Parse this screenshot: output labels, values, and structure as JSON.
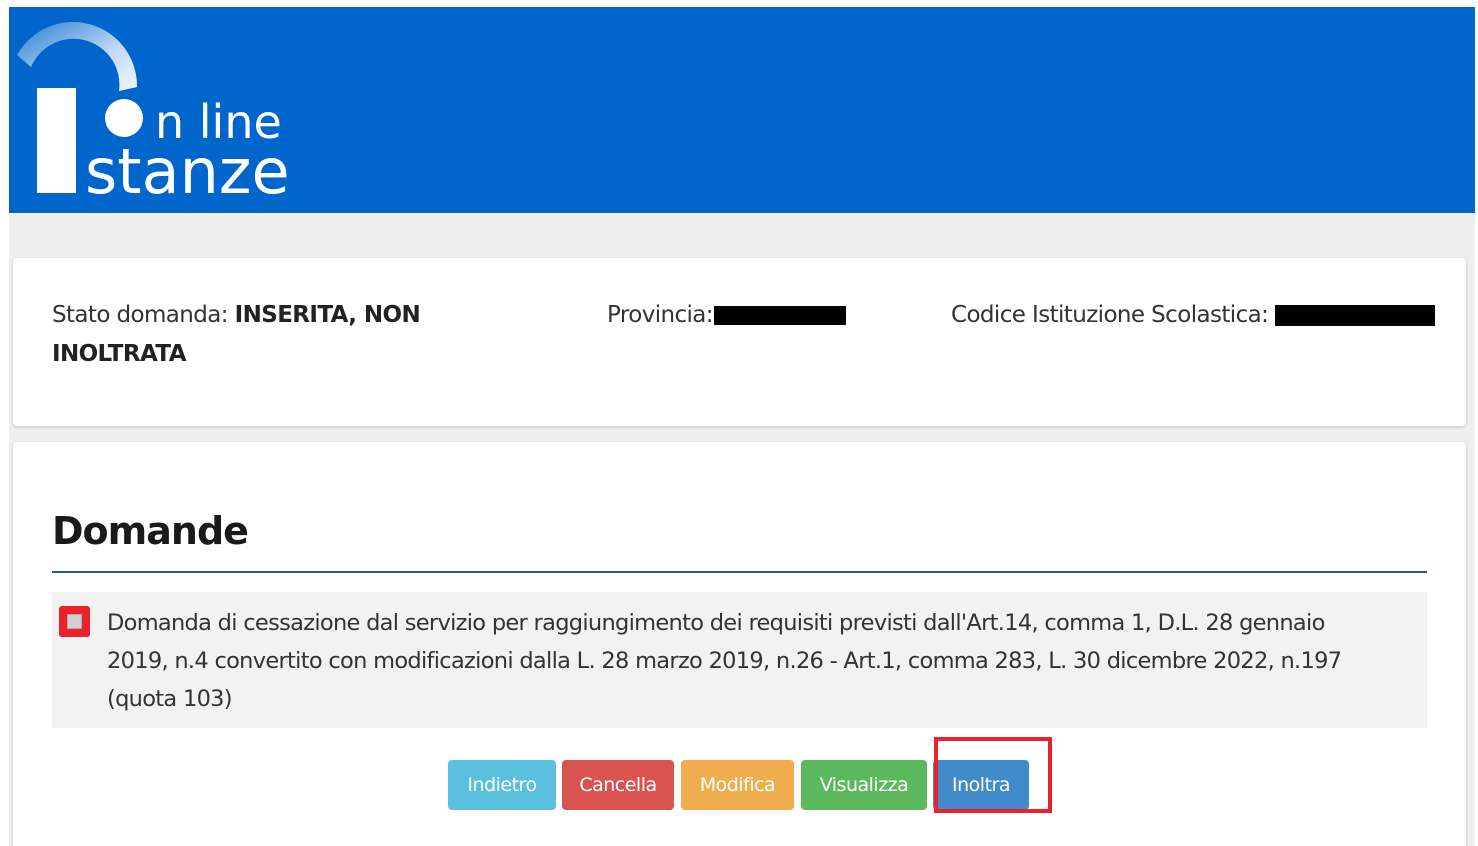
{
  "header": {
    "logo_line1": "n line",
    "logo_line2": "stanze",
    "colors": {
      "header_bg": "#0066cc"
    }
  },
  "info": {
    "stato_label": "Stato domanda:",
    "stato_value_line1": "INSERITA, NON",
    "stato_value_line2": "INOLTRATA",
    "provincia_label": "Provincia:",
    "codice_label": "Codice Istituzione Scolastica:"
  },
  "domande": {
    "title": "Domande",
    "items": [
      {
        "text_line1": "Domanda di cessazione dal servizio per raggiungimento dei requisiti previsti dall'Art.14, comma 1, D.L. 28 gennaio",
        "text_line2": "2019, n.4 convertito con modificazioni dalla L. 28 marzo 2019, n.26 - Art.1, comma 283, L. 30 dicembre 2022, n.197",
        "text_line3": "(quota 103)"
      }
    ]
  },
  "buttons": {
    "indietro": "Indietro",
    "cancella": "Cancella",
    "modifica": "Modifica",
    "visualizza": "Visualizza",
    "inoltra": "Inoltra"
  },
  "colors": {
    "indietro": "#5bc0de",
    "cancella": "#d9534f",
    "modifica": "#f0ad4e",
    "visualizza": "#5cb85c",
    "inoltra": "#428bca",
    "highlight": "#e8232b"
  }
}
